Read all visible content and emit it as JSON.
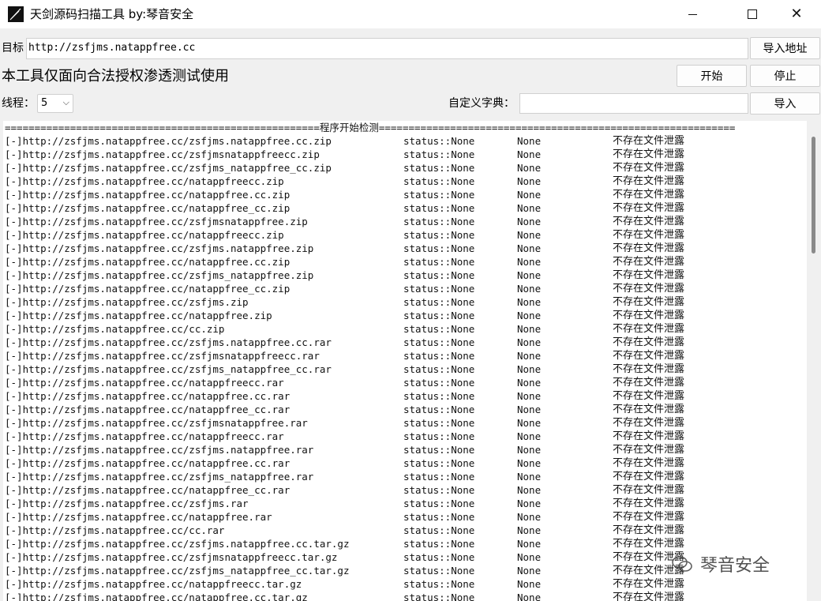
{
  "window": {
    "title": "天剑源码扫描工具 by:琴音安全"
  },
  "toolbar": {
    "target_label": "目标",
    "target_value": "http://zsfjms.natappfree.cc",
    "import_address_button": "导入地址",
    "notice": "本工具仅面向合法授权渗透测试使用",
    "start_button": "开始",
    "stop_button": "停止",
    "threads_label": "线程：",
    "threads_value": "5",
    "dict_label": "自定义字典：",
    "dict_value": "",
    "import_button": "导入"
  },
  "output": {
    "header": "=====================================================程序开始检测============================================================",
    "rows": [
      {
        "url": "[-]http://zsfjms.natappfree.cc/zsfjms.natappfree.cc.zip",
        "status": "status::None",
        "code": "None",
        "msg": "不存在文件泄露"
      },
      {
        "url": "[-]http://zsfjms.natappfree.cc/zsfjmsnatappfreecc.zip",
        "status": "status::None",
        "code": "None",
        "msg": "不存在文件泄露"
      },
      {
        "url": "[-]http://zsfjms.natappfree.cc/zsfjms_natappfree_cc.zip",
        "status": "status::None",
        "code": "None",
        "msg": "不存在文件泄露"
      },
      {
        "url": "[-]http://zsfjms.natappfree.cc/natappfreecc.zip",
        "status": "status::None",
        "code": "None",
        "msg": "不存在文件泄露"
      },
      {
        "url": "[-]http://zsfjms.natappfree.cc/natappfree.cc.zip",
        "status": "status::None",
        "code": "None",
        "msg": "不存在文件泄露"
      },
      {
        "url": "[-]http://zsfjms.natappfree.cc/natappfree_cc.zip",
        "status": "status::None",
        "code": "None",
        "msg": "不存在文件泄露"
      },
      {
        "url": "[-]http://zsfjms.natappfree.cc/zsfjmsnatappfree.zip",
        "status": "status::None",
        "code": "None",
        "msg": "不存在文件泄露"
      },
      {
        "url": "[-]http://zsfjms.natappfree.cc/natappfreecc.zip",
        "status": "status::None",
        "code": "None",
        "msg": "不存在文件泄露"
      },
      {
        "url": "[-]http://zsfjms.natappfree.cc/zsfjms.natappfree.zip",
        "status": "status::None",
        "code": "None",
        "msg": "不存在文件泄露"
      },
      {
        "url": "[-]http://zsfjms.natappfree.cc/natappfree.cc.zip",
        "status": "status::None",
        "code": "None",
        "msg": "不存在文件泄露"
      },
      {
        "url": "[-]http://zsfjms.natappfree.cc/zsfjms_natappfree.zip",
        "status": "status::None",
        "code": "None",
        "msg": "不存在文件泄露"
      },
      {
        "url": "[-]http://zsfjms.natappfree.cc/natappfree_cc.zip",
        "status": "status::None",
        "code": "None",
        "msg": "不存在文件泄露"
      },
      {
        "url": "[-]http://zsfjms.natappfree.cc/zsfjms.zip",
        "status": "status::None",
        "code": "None",
        "msg": "不存在文件泄露"
      },
      {
        "url": "[-]http://zsfjms.natappfree.cc/natappfree.zip",
        "status": "status::None",
        "code": "None",
        "msg": "不存在文件泄露"
      },
      {
        "url": "[-]http://zsfjms.natappfree.cc/cc.zip",
        "status": "status::None",
        "code": "None",
        "msg": "不存在文件泄露"
      },
      {
        "url": "[-]http://zsfjms.natappfree.cc/zsfjms.natappfree.cc.rar",
        "status": "status::None",
        "code": "None",
        "msg": "不存在文件泄露"
      },
      {
        "url": "[-]http://zsfjms.natappfree.cc/zsfjmsnatappfreecc.rar",
        "status": "status::None",
        "code": "None",
        "msg": "不存在文件泄露"
      },
      {
        "url": "[-]http://zsfjms.natappfree.cc/zsfjms_natappfree_cc.rar",
        "status": "status::None",
        "code": "None",
        "msg": "不存在文件泄露"
      },
      {
        "url": "[-]http://zsfjms.natappfree.cc/natappfreecc.rar",
        "status": "status::None",
        "code": "None",
        "msg": "不存在文件泄露"
      },
      {
        "url": "[-]http://zsfjms.natappfree.cc/natappfree.cc.rar",
        "status": "status::None",
        "code": "None",
        "msg": "不存在文件泄露"
      },
      {
        "url": "[-]http://zsfjms.natappfree.cc/natappfree_cc.rar",
        "status": "status::None",
        "code": "None",
        "msg": "不存在文件泄露"
      },
      {
        "url": "[-]http://zsfjms.natappfree.cc/zsfjmsnatappfree.rar",
        "status": "status::None",
        "code": "None",
        "msg": "不存在文件泄露"
      },
      {
        "url": "[-]http://zsfjms.natappfree.cc/natappfreecc.rar",
        "status": "status::None",
        "code": "None",
        "msg": "不存在文件泄露"
      },
      {
        "url": "[-]http://zsfjms.natappfree.cc/zsfjms.natappfree.rar",
        "status": "status::None",
        "code": "None",
        "msg": "不存在文件泄露"
      },
      {
        "url": "[-]http://zsfjms.natappfree.cc/natappfree.cc.rar",
        "status": "status::None",
        "code": "None",
        "msg": "不存在文件泄露"
      },
      {
        "url": "[-]http://zsfjms.natappfree.cc/zsfjms_natappfree.rar",
        "status": "status::None",
        "code": "None",
        "msg": "不存在文件泄露"
      },
      {
        "url": "[-]http://zsfjms.natappfree.cc/natappfree_cc.rar",
        "status": "status::None",
        "code": "None",
        "msg": "不存在文件泄露"
      },
      {
        "url": "[-]http://zsfjms.natappfree.cc/zsfjms.rar",
        "status": "status::None",
        "code": "None",
        "msg": "不存在文件泄露"
      },
      {
        "url": "[-]http://zsfjms.natappfree.cc/natappfree.rar",
        "status": "status::None",
        "code": "None",
        "msg": "不存在文件泄露"
      },
      {
        "url": "[-]http://zsfjms.natappfree.cc/cc.rar",
        "status": "status::None",
        "code": "None",
        "msg": "不存在文件泄露"
      },
      {
        "url": "[-]http://zsfjms.natappfree.cc/zsfjms.natappfree.cc.tar.gz",
        "status": "status::None",
        "code": "None",
        "msg": "不存在文件泄露"
      },
      {
        "url": "[-]http://zsfjms.natappfree.cc/zsfjmsnatappfreecc.tar.gz",
        "status": "status::None",
        "code": "None",
        "msg": "不存在文件泄露"
      },
      {
        "url": "[-]http://zsfjms.natappfree.cc/zsfjms_natappfree_cc.tar.gz",
        "status": "status::None",
        "code": "None",
        "msg": "不存在文件泄露"
      },
      {
        "url": "[-]http://zsfjms.natappfree.cc/natappfreecc.tar.gz",
        "status": "status::None",
        "code": "None",
        "msg": "不存在文件泄露"
      },
      {
        "url": "[-]http://zsfjms.natappfree.cc/natappfree.cc.tar.gz",
        "status": "status::None",
        "code": "None",
        "msg": "不存在文件泄露"
      }
    ]
  },
  "watermark": {
    "text": "琴音安全"
  },
  "icons": {
    "app": "feather-pen-icon",
    "minimize": "minimize-icon",
    "maximize": "maximize-icon",
    "close": "close-icon",
    "combo_arrow": "chevron-down-icon",
    "watermark": "wechat-logo-icon"
  }
}
